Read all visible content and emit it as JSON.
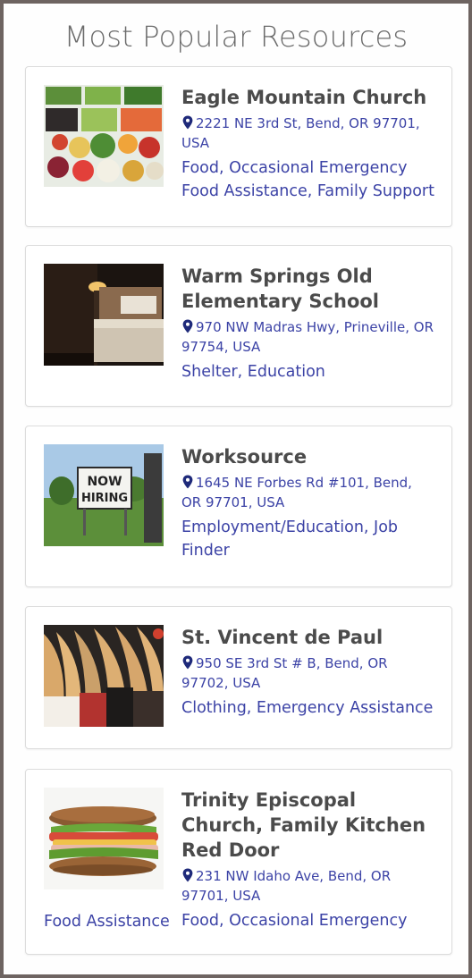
{
  "page": {
    "title": "Most Popular Resources"
  },
  "resources": [
    {
      "name": "Eagle Mountain Church",
      "address": "2221 NE 3rd St, Bend, OR 97701, USA",
      "categories": "Food, Occasional Emergency Food Assistance, Family Support",
      "image": "vegetables-photo"
    },
    {
      "name": "Warm Springs Old Elementary School",
      "address": "970 NW Madras Hwy, Prineville, OR 97754, USA",
      "categories": "Shelter, Education",
      "image": "bedroom-photo"
    },
    {
      "name": "Worksource",
      "address": "1645 NE Forbes Rd #101, Bend, OR 97701, USA",
      "categories": "Employment/Education, Job Finder",
      "image": "now-hiring-sign-photo",
      "sign_text_1": "NOW",
      "sign_text_2": "HIRING"
    },
    {
      "name": "St. Vincent de Paul",
      "address": "950 SE 3rd St # B, Bend, OR 97702, USA",
      "categories": "Clothing, Emergency Assistance",
      "image": "clothes-hangers-photo"
    },
    {
      "name": "Trinity Episcopal Church, Family Kitchen Red Door",
      "address": "231 NW Idaho Ave, Bend, OR 97701, USA",
      "categories_line1": "Food, Occasional Emergency",
      "categories_line2": "Food Assistance",
      "image": "sandwich-photo"
    }
  ],
  "colors": {
    "frame": "#6e6461",
    "link": "#3c43a6",
    "pin": "#1f2a7a",
    "title": "#6b6b6b"
  }
}
